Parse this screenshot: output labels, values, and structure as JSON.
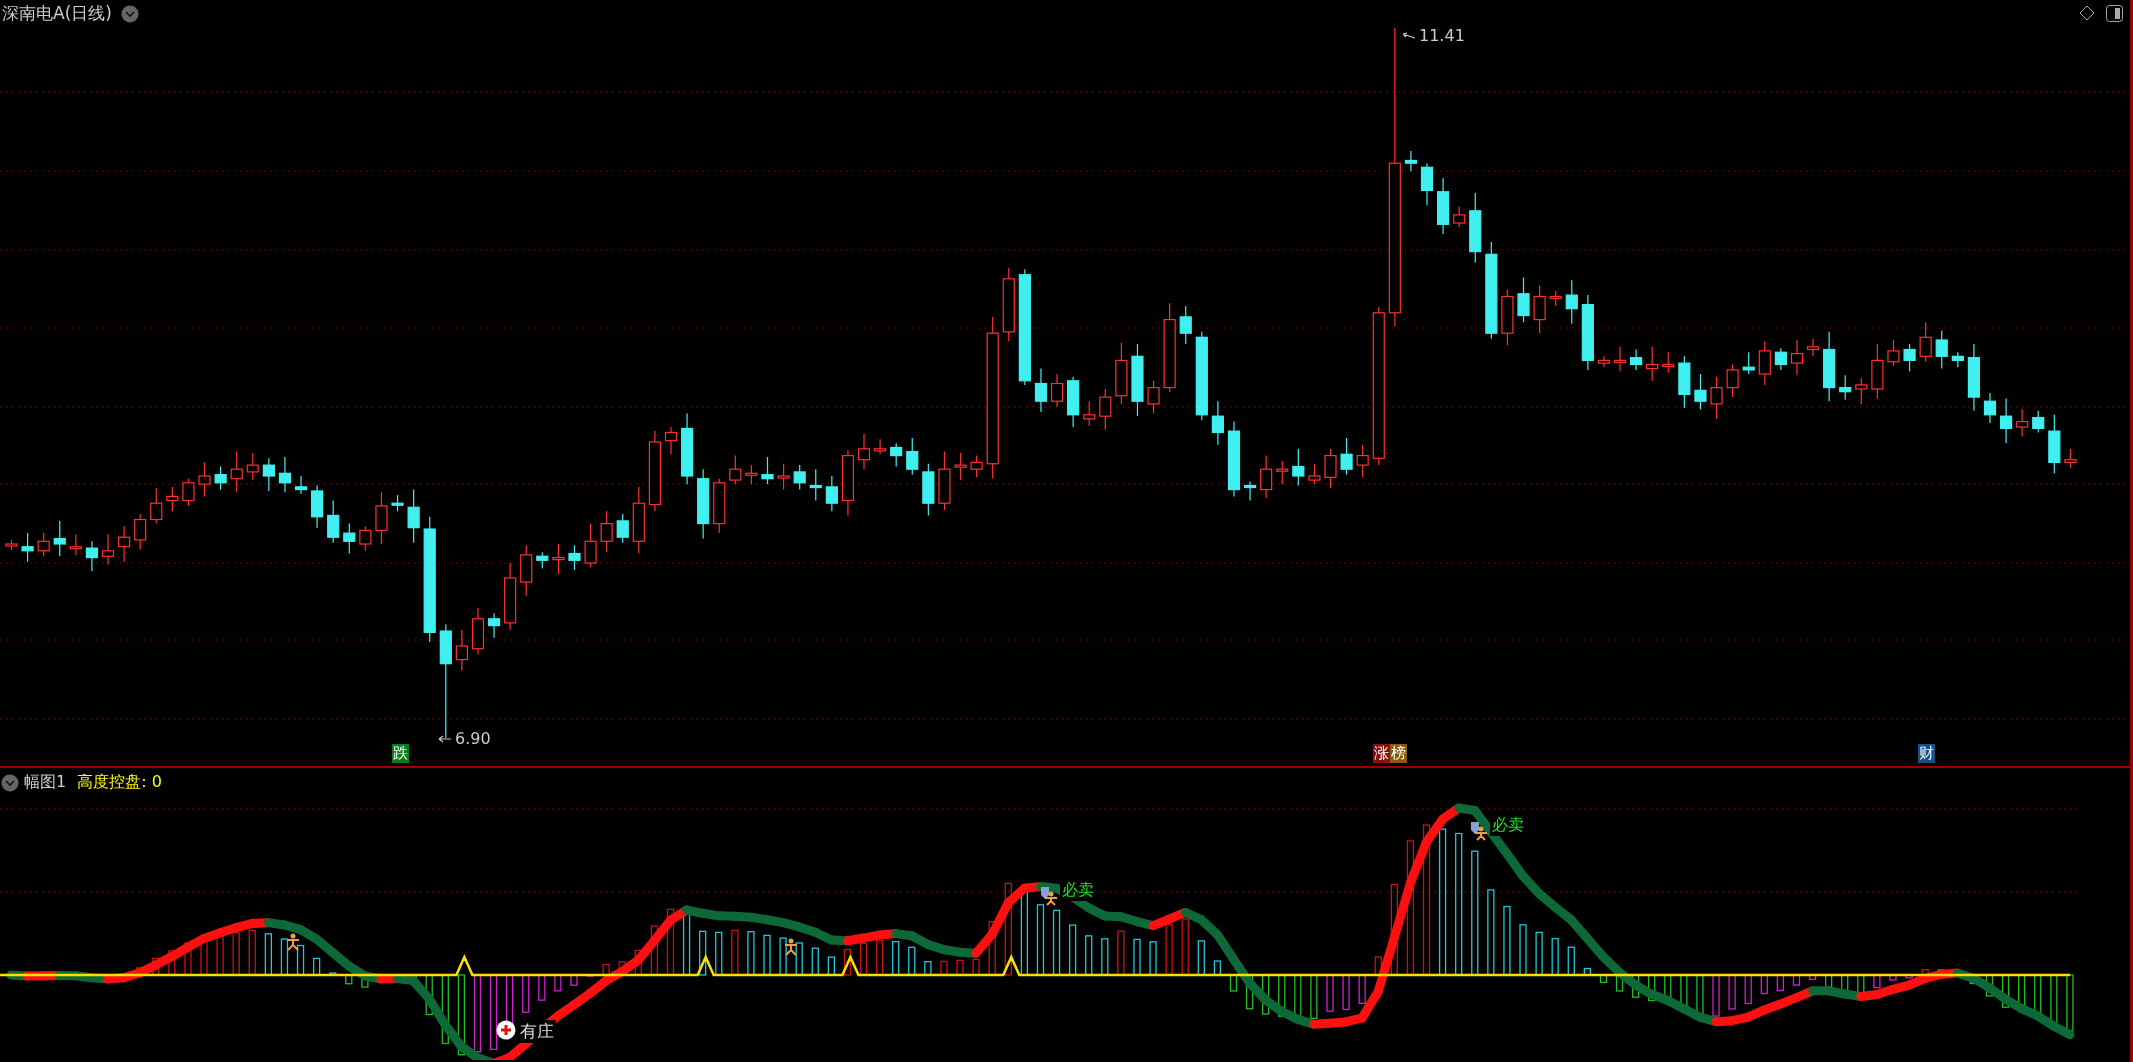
{
  "chart": {
    "title": "深南电A(日线)",
    "high_label": "11.41",
    "low_label": "6.90",
    "markers": [
      {
        "parts": [
          {
            "text": "跌",
            "color": "#0a7d1a"
          }
        ]
      },
      {
        "parts": [
          {
            "text": "涨",
            "color": "#8a0f0f"
          },
          {
            "text": "榜",
            "color": "#8a5a10"
          }
        ]
      },
      {
        "parts": [
          {
            "text": "财",
            "color": "#1c4f86"
          }
        ]
      }
    ]
  },
  "sub_chart": {
    "title": "幅图1",
    "indicator": "高度控盘: 0",
    "signals": [
      {
        "kind": "sell",
        "text": "必卖"
      },
      {
        "kind": "sell",
        "text": "必卖"
      },
      {
        "kind": "banker",
        "text": "有庄"
      }
    ]
  }
}
